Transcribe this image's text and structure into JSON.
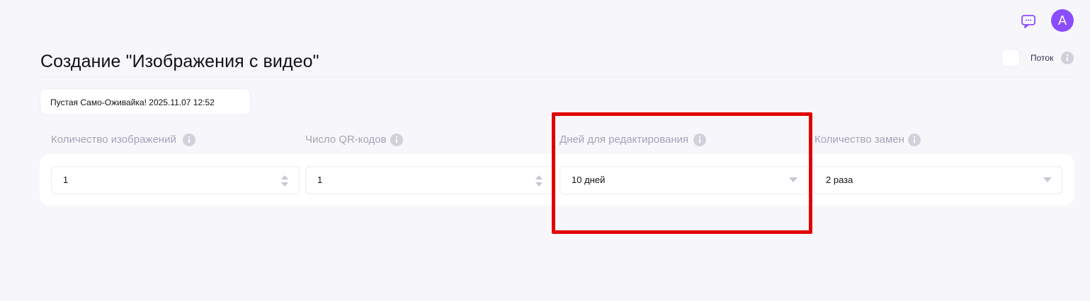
{
  "header": {
    "avatar_initial": "A",
    "chat_icon": "chat-icon"
  },
  "page": {
    "title": "Создание \"Изображения с видео\"",
    "flow_label": "Поток",
    "name_value": "Пустая Само-Оживайка! 2025.11.07 12:52"
  },
  "labels": {
    "images_count": "Количество изображений",
    "qr_count": "Число QR-кодов",
    "edit_days": "Дней для редактирования",
    "replacements": "Количество замен"
  },
  "fields": {
    "images_count_value": "1",
    "qr_count_value": "1",
    "edit_days_value": "10 дней",
    "replacements_value": "2 раза"
  },
  "colors": {
    "accent": "#8a4dff",
    "highlight": "#e00000",
    "label_text": "#a8a0b5",
    "info_icon": "#d2d0da"
  }
}
